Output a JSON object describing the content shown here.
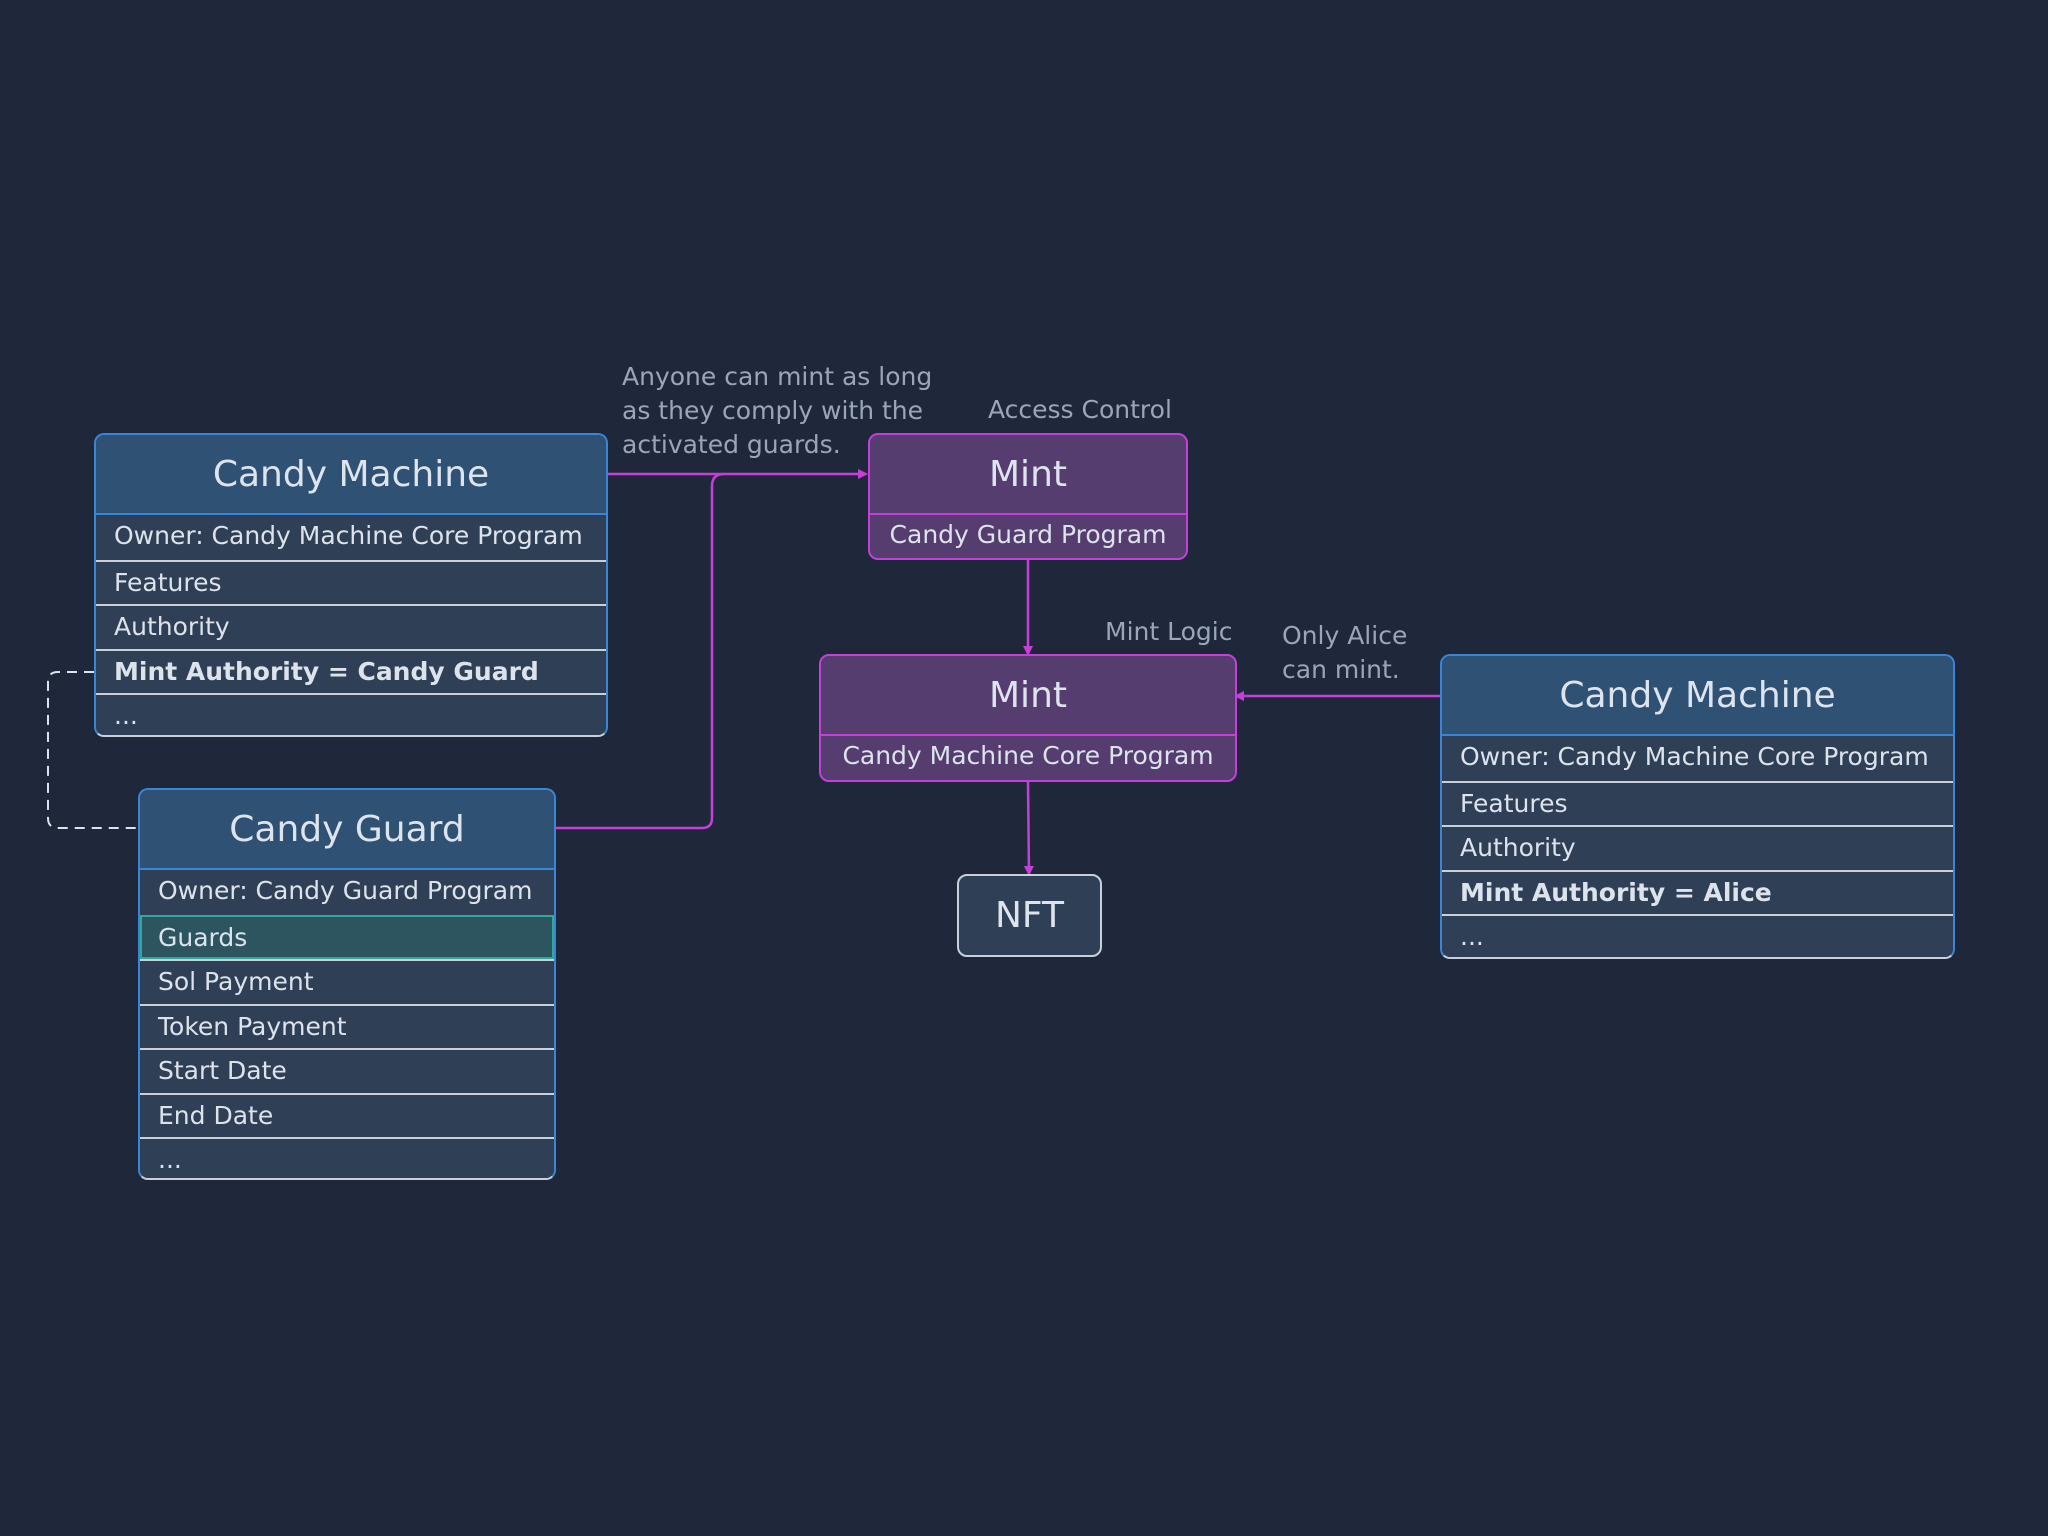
{
  "candy_machine_left": {
    "title": "Candy Machine",
    "rows": [
      "Owner: Candy Machine Core Program",
      "Features",
      "Authority",
      "Mint Authority = Candy Guard",
      "..."
    ]
  },
  "candy_guard": {
    "title": "Candy Guard",
    "rows": [
      "Owner: Candy Guard Program",
      "Guards",
      "Sol Payment",
      "Token Payment",
      "Start Date",
      "End Date",
      "..."
    ]
  },
  "mint_guard": {
    "title": "Mint",
    "subtitle": "Candy Guard Program"
  },
  "mint_core": {
    "title": "Mint",
    "subtitle": "Candy Machine Core Program"
  },
  "nft": {
    "title": "NFT"
  },
  "candy_machine_right": {
    "title": "Candy Machine",
    "rows": [
      "Owner: Candy Machine Core Program",
      "Features",
      "Authority",
      "Mint Authority = Alice",
      "..."
    ]
  },
  "labels": {
    "anyone_line1": "Anyone can mint as long",
    "anyone_line2": "as they comply with the",
    "anyone_line3": "activated guards.",
    "access_control": "Access Control",
    "mint_logic": "Mint Logic",
    "only_alice_line1": "Only Alice",
    "only_alice_line2": "can mint."
  },
  "colors": {
    "background": "#1e283a",
    "account_border": "#3a86d6",
    "instruction_border": "#c53fd8",
    "highlight": "#2ea99a"
  }
}
